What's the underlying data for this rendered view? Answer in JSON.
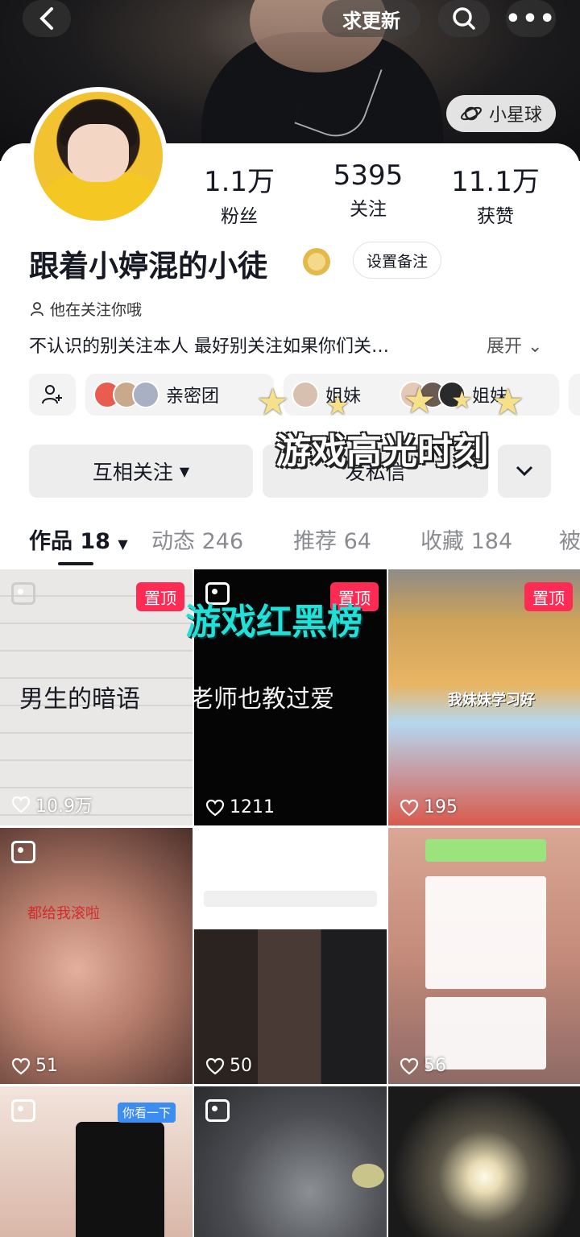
{
  "topbar": {
    "update_label": "求更新",
    "planet_label": "小星球"
  },
  "profile": {
    "name": "跟着小婷混的小徒",
    "remark_label": "设置备注",
    "follow_note": "他在关注你哦",
    "bio": "不认识的别关注本人 最好别关注如果你们关…",
    "expand_label": "展开",
    "stats": [
      {
        "num": "1.1万",
        "label": "粉丝"
      },
      {
        "num": "5395",
        "label": "关注"
      },
      {
        "num": "11.1万",
        "label": "获赞"
      }
    ]
  },
  "chips": {
    "group1": "亲密团",
    "group2": "姐妹",
    "group3": "姐妹"
  },
  "overlays": {
    "game_title": "游戏高光时刻",
    "redblack": "游戏红黑榜"
  },
  "actions": {
    "mutual": "互相关注",
    "message": "发私信"
  },
  "tabs": [
    {
      "label": "作品 18"
    },
    {
      "label": "动态 246"
    },
    {
      "label": "推荐 64"
    },
    {
      "label": "收藏 184"
    },
    {
      "label": "被"
    }
  ],
  "grid": {
    "pin_label": "置顶",
    "tiles": [
      {
        "text": "男生的暗语",
        "likes": "10.9万"
      },
      {
        "text": "老师也教过爱",
        "likes": "1211"
      },
      {
        "text": "我妹妹学习好",
        "likes": "195"
      },
      {
        "text": "都给我滚啦",
        "likes": "51"
      },
      {
        "text": "",
        "likes": "50"
      },
      {
        "text": "",
        "likes": "56"
      },
      {
        "text": "你看一下",
        "likes": ""
      },
      {
        "text": "",
        "likes": ""
      },
      {
        "text": "",
        "likes": ""
      }
    ]
  },
  "colors": {
    "accent": "#fe2c55",
    "text": "#161823",
    "subtext": "#8a8b91",
    "banner": "#20e0d8"
  }
}
